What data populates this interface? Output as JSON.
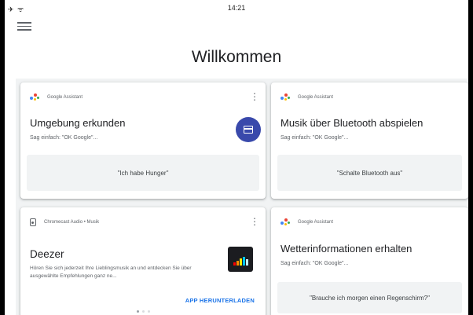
{
  "status_bar": {
    "icons": "✈ ᯤ",
    "time": "14:21"
  },
  "page_title": "Willkommen",
  "colors": {
    "accent": "#3949ab",
    "link": "#1a73e8",
    "background": "#f1f3f4"
  },
  "cards": [
    {
      "header": "Google Assistant",
      "title": "Umgebung erkunden",
      "subtitle": "Sag einfach: \"OK Google\"...",
      "query": "\"Ich habe Hunger\"",
      "icon": "calendar-icon"
    },
    {
      "header": "Google Assistant",
      "title": "Musik über Bluetooth abspielen",
      "subtitle": "Sag einfach: \"OK Google\"...",
      "query": "\"Schalte Bluetooth aus\""
    },
    {
      "header": "Chromecast Audio • Musik",
      "title": "Deezer",
      "description": "Hören Sie sich jederzeit Ihre Lieblingsmusik an und entdecken Sie über ausgewählte Empfehlungen ganz ne...",
      "action": "APP HERUNTERLADEN",
      "icon": "deezer-logo"
    },
    {
      "header": "Google Assistant",
      "title": "Wetterinformationen erhalten",
      "subtitle": "Sag einfach: \"OK Google\"...",
      "query": "\"Brauche ich morgen einen Regenschirm?\""
    }
  ]
}
